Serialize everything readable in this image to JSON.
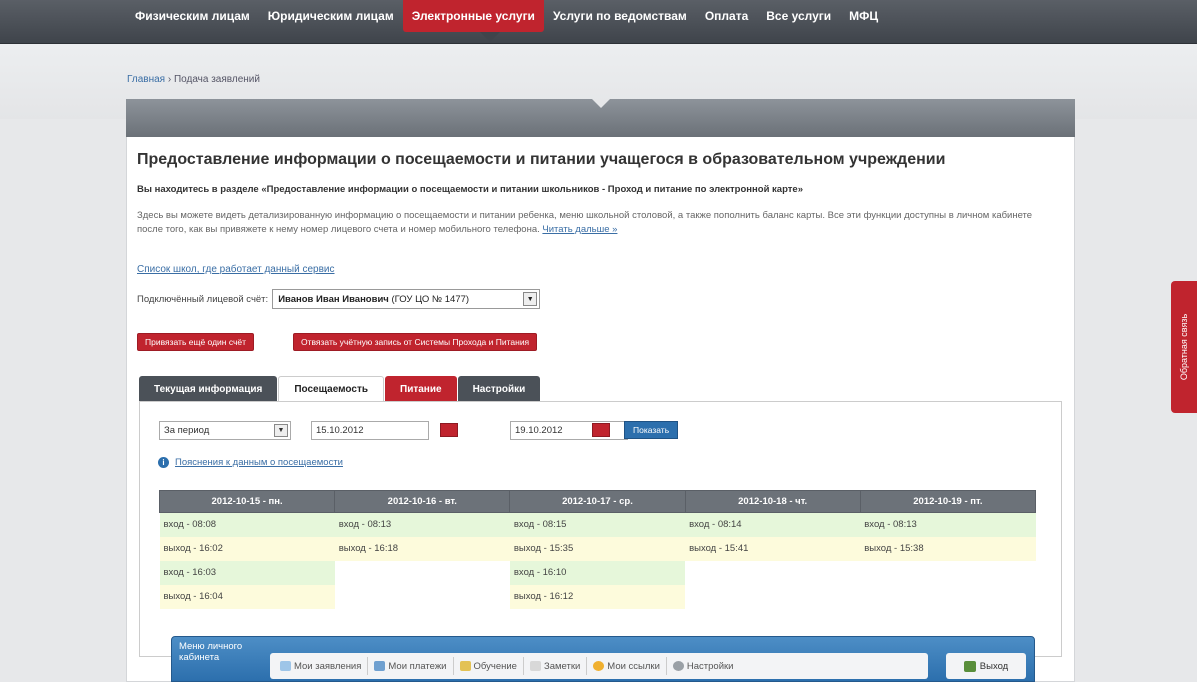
{
  "topnav": {
    "items": [
      {
        "label": "Физическим лицам"
      },
      {
        "label": "Юридическим лицам"
      },
      {
        "label": "Электронные услуги",
        "active": true
      },
      {
        "label": "Услуги по ведомствам"
      },
      {
        "label": "Оплата"
      },
      {
        "label": "Все услуги"
      },
      {
        "label": "МФЦ"
      }
    ]
  },
  "breadcrumb": {
    "home": "Главная",
    "separator": "›",
    "current": "Подача заявлений"
  },
  "page": {
    "title": "Предоставление информации о посещаемости и питании учащегося в образовательном учреждении",
    "subtitle": "Вы находитесь в разделе «Предоставление информации о посещаемости и питании школьников - Проход и питание по электронной карте»",
    "description": "Здесь вы можете видеть детализированную информацию о посещаемости и питании ребенка, меню школьной столовой, а также пополнить баланс карты. Все эти функции доступны в личном кабинете после того, как вы привяжете к нему номер лицевого счета и номер мобильного телефона.",
    "read_more": "Читать дальше »",
    "schools_link": "Список школ, где работает данный сервис",
    "account_label": "Подключённый лицевой счёт:",
    "account_owner": "Иванов Иван Иванович",
    "account_school": "(ГОУ ЦО № 1477)",
    "btn_link_another": "Привязать ещё один счёт",
    "btn_unlink": "Отвязать учётную запись от Системы Прохода и Питания"
  },
  "tabs": [
    {
      "label": "Текущая информация",
      "style": "dark"
    },
    {
      "label": "Посещаемость",
      "style": "active"
    },
    {
      "label": "Питание",
      "style": "red"
    },
    {
      "label": "Настройки",
      "style": "dark"
    }
  ],
  "filter": {
    "period": "За период",
    "date_from": "15.10.2012",
    "date_to": "19.10.2012",
    "show_button": "Показать",
    "info_link": "Пояснения к данным о посещаемости"
  },
  "attendance": {
    "columns": [
      "2012-10-15 - пн.",
      "2012-10-16 - вт.",
      "2012-10-17 - ср.",
      "2012-10-18 - чт.",
      "2012-10-19 - пт."
    ],
    "rows": [
      {
        "type": "in",
        "cells": [
          "вход - 08:08",
          "вход - 08:13",
          "вход - 08:15",
          "вход - 08:14",
          "вход - 08:13"
        ]
      },
      {
        "type": "out",
        "cells": [
          "выход - 16:02",
          "выход - 16:18",
          "выход - 15:35",
          "выход - 15:41",
          "выход - 15:38"
        ]
      },
      {
        "type": "in",
        "cells": [
          "вход - 16:03",
          "",
          "вход - 16:10",
          "",
          ""
        ]
      },
      {
        "type": "out",
        "cells": [
          "выход - 16:04",
          "",
          "выход - 16:12",
          "",
          ""
        ]
      }
    ]
  },
  "cabinet": {
    "title": "Меню личного кабинета",
    "items": [
      {
        "label": "Мои заявления",
        "icon": "document-icon"
      },
      {
        "label": "Мои платежи",
        "icon": "payments-icon"
      },
      {
        "label": "Обучение",
        "icon": "book-icon"
      },
      {
        "label": "Заметки",
        "icon": "note-icon"
      },
      {
        "label": "Мои ссылки",
        "icon": "star-icon"
      },
      {
        "label": "Настройки",
        "icon": "settings-icon"
      }
    ],
    "exit": "Выход"
  },
  "feedback": "Обратная связь",
  "colors": {
    "brand_red": "#c0242e",
    "accent_blue": "#2c6fad",
    "nav_dark": "#4b5158"
  }
}
